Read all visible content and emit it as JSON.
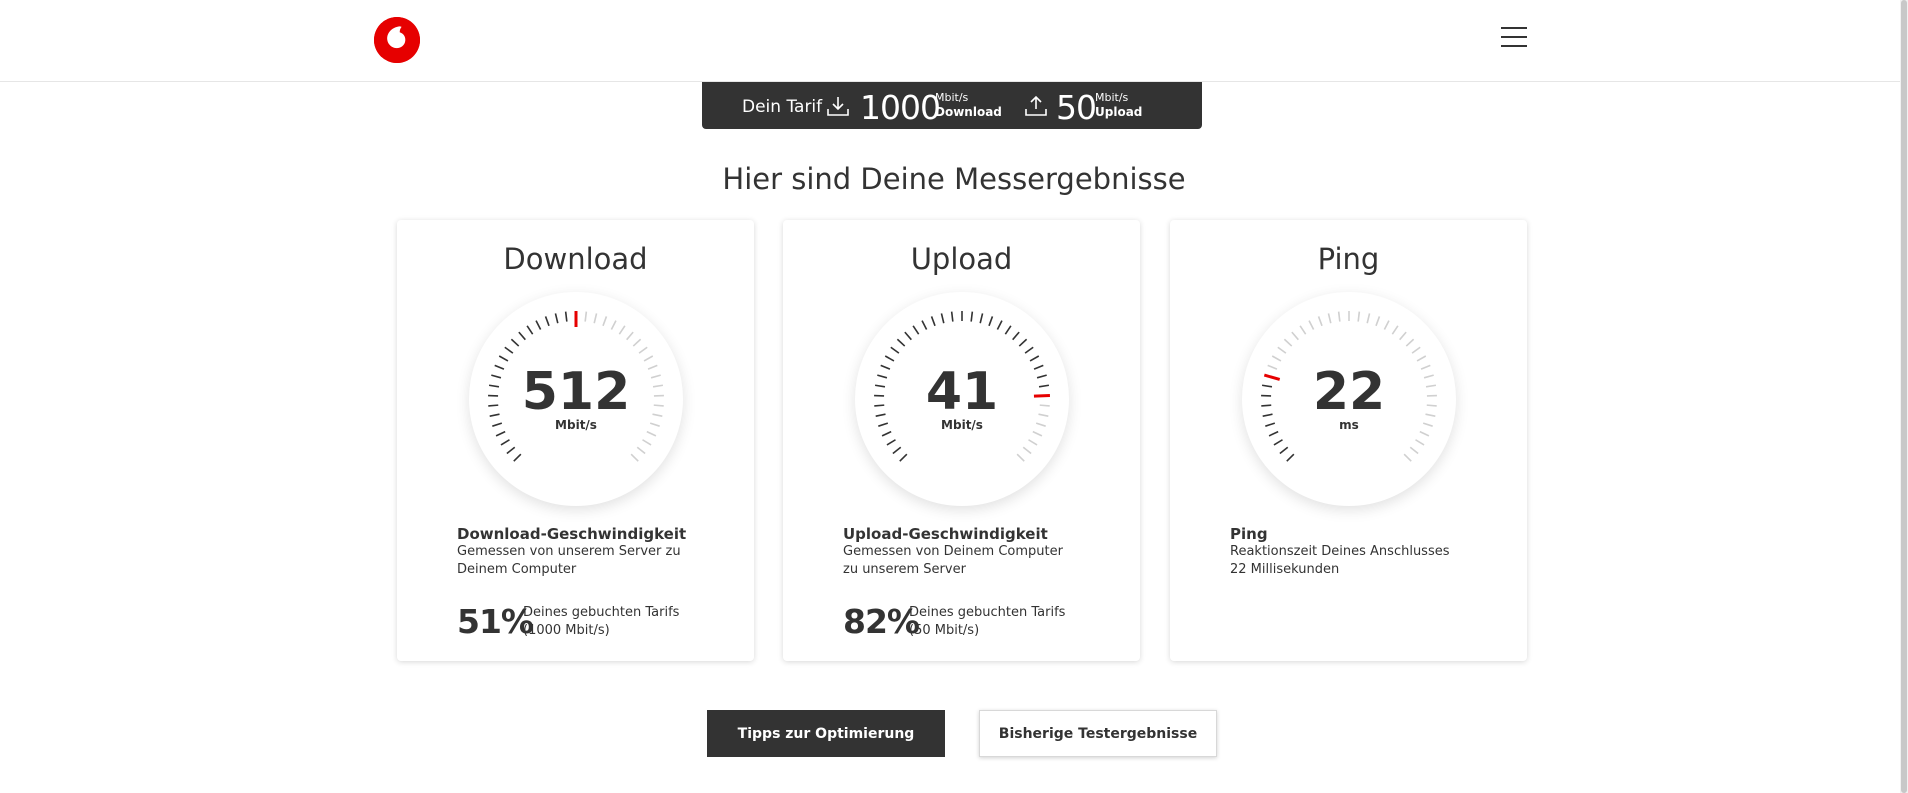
{
  "header": {
    "logo_icon": "vodafone-logo",
    "menu_icon": "hamburger-menu-icon"
  },
  "tariff": {
    "label": "Dein Tarif",
    "download_value": "1000",
    "download_unit": "Mbit/s",
    "download_label": "Download",
    "upload_value": "50",
    "upload_unit": "Mbit/s",
    "upload_label": "Upload"
  },
  "heading": "Hier sind Deine Messergebnisse",
  "cards": [
    {
      "title": "Download",
      "value": "512",
      "unit": "Mbit/s",
      "gauge_fraction": 0.51,
      "sub_title": "Download-Geschwindigkeit",
      "description": "Gemessen von unserem Server zu Deinem Computer",
      "percent": "51%",
      "percent_note_line1": "Deines gebuchten Tarifs",
      "percent_note_line2": "(1000 Mbit/s)"
    },
    {
      "title": "Upload",
      "value": "41",
      "unit": "Mbit/s",
      "gauge_fraction": 0.82,
      "sub_title": "Upload-Geschwindigkeit",
      "description": "Gemessen von Deinem Computer zu unserem Server",
      "percent": "82%",
      "percent_note_line1": "Deines gebuchten Tarifs",
      "percent_note_line2": "(50 Mbit/s)"
    },
    {
      "title": "Ping",
      "value": "22",
      "unit": "ms",
      "gauge_fraction": 0.22,
      "sub_title": "Ping",
      "description_line1": "Reaktionszeit Deines Anschlusses",
      "description_line2": "22 Millisekunden"
    }
  ],
  "buttons": {
    "primary": "Tipps zur Optimierung",
    "secondary": "Bisherige Testergebnisse"
  },
  "colors": {
    "accent": "#e60000",
    "dark": "#333333",
    "tick_inactive": "#d0d0d0"
  }
}
